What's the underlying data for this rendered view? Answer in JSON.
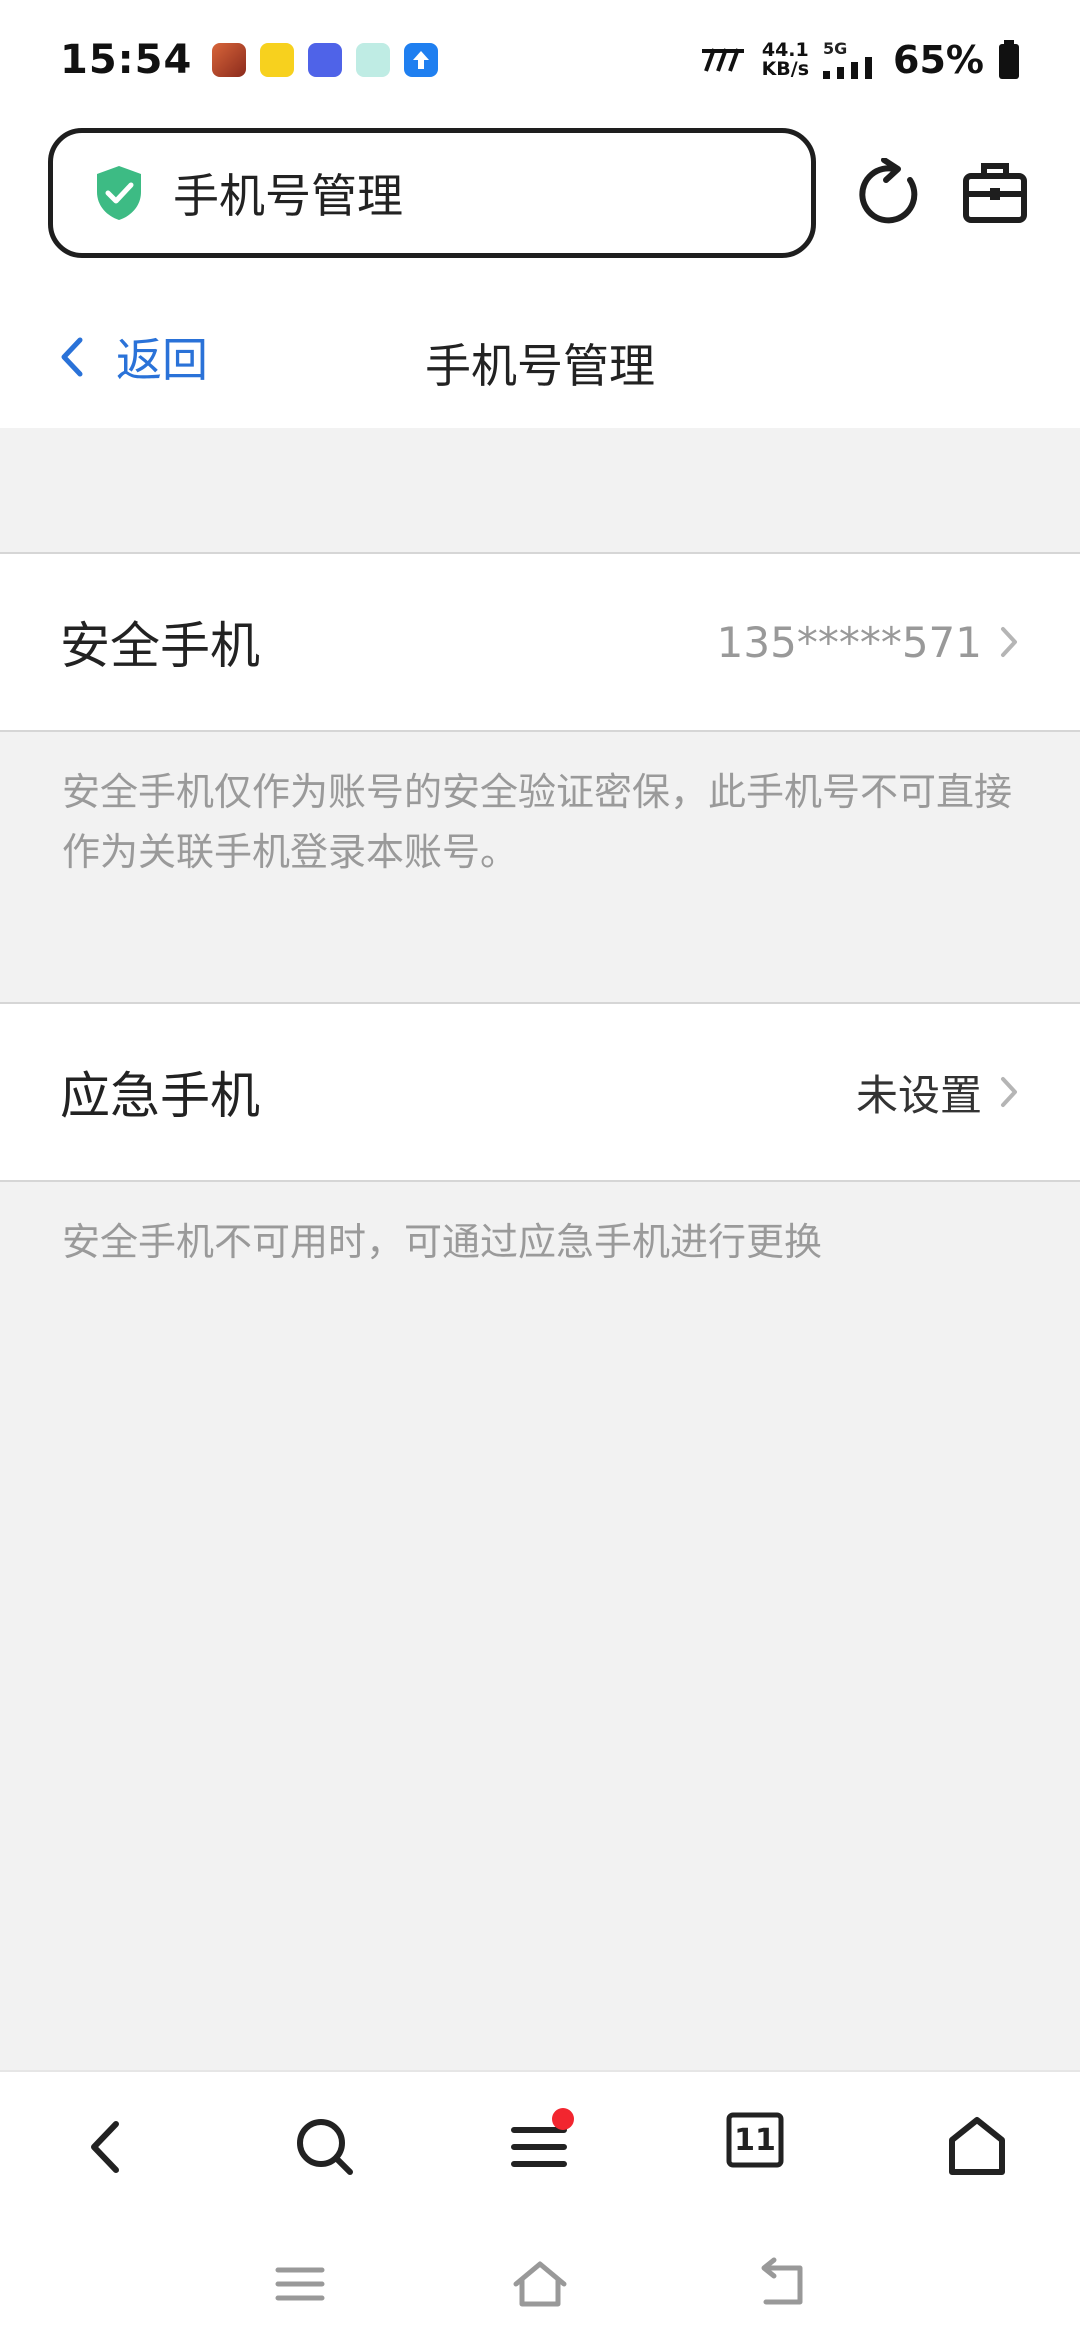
{
  "status_bar": {
    "time": "15:54",
    "net_speed_value": "44.1",
    "net_speed_unit": "KB/s",
    "network_type": "5G",
    "battery": "65%"
  },
  "browser": {
    "address_text": "手机号管理",
    "shield_color": "#3dbb84"
  },
  "header": {
    "back_label": "返回",
    "title": "手机号管理"
  },
  "security_phone": {
    "label": "安全手机",
    "value": "135*****571",
    "hint": "安全手机仅作为账号的安全验证密保，此手机号不可直接作为关联手机登录本账号。"
  },
  "emergency_phone": {
    "label": "应急手机",
    "value": "未设置",
    "hint": "安全手机不可用时，可通过应急手机进行更换"
  },
  "bottom_nav": {
    "tab_count": "11"
  },
  "colors": {
    "accent": "#2a72d8",
    "badge": "#f2262f"
  }
}
